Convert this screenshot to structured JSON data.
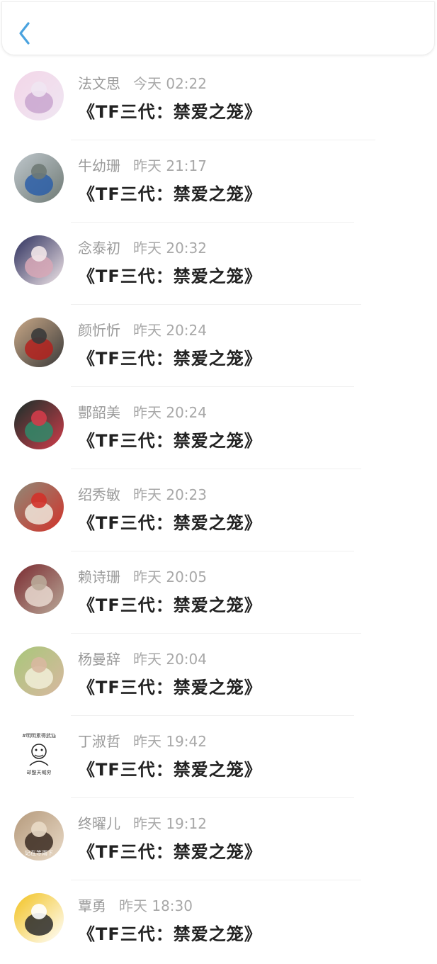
{
  "header": {
    "back_icon": "chevron-left-icon",
    "accent": "#4aa3df"
  },
  "items": [
    {
      "name": "法文思",
      "time": "今天 02:22",
      "title": "《TF三代：禁爱之笼》",
      "avatar": {
        "c1": "#f3d6e8",
        "c2": "#c9a6cf",
        "c3": "#efe6f2"
      }
    },
    {
      "name": "牛幼珊",
      "time": "昨天 21:17",
      "title": "《TF三代：禁爱之笼》",
      "avatar": {
        "c1": "#bfc7cc",
        "c2": "#2d5fa8",
        "c3": "#6f7a75"
      }
    },
    {
      "name": "念泰初",
      "time": "昨天 20:32",
      "title": "《TF三代：禁爱之笼》",
      "avatar": {
        "c1": "#2b2e5c",
        "c2": "#d7a7b6",
        "c3": "#f1e5e8"
      }
    },
    {
      "name": "颜忻忻",
      "time": "昨天 20:24",
      "title": "《TF三代：禁爱之笼》",
      "avatar": {
        "c1": "#c9a887",
        "c2": "#b3221e",
        "c3": "#3a3a3a"
      }
    },
    {
      "name": "酆韶美",
      "time": "昨天 20:24",
      "title": "《TF三代：禁爱之笼》",
      "avatar": {
        "c1": "#15302a",
        "c2": "#2f8a6a",
        "c3": "#d13c4a"
      }
    },
    {
      "name": "绍秀敏",
      "time": "昨天 20:23",
      "title": "《TF三代：禁爱之笼》",
      "avatar": {
        "c1": "#8f8a78",
        "c2": "#efe7dc",
        "c3": "#d2322a"
      }
    },
    {
      "name": "赖诗珊",
      "time": "昨天 20:05",
      "title": "《TF三代：禁爱之笼》",
      "avatar": {
        "c1": "#7a2a30",
        "c2": "#e7d8cf",
        "c3": "#b9a898"
      }
    },
    {
      "name": "杨曼辞",
      "time": "昨天 20:04",
      "title": "《TF三代：禁爱之笼》",
      "avatar": {
        "c1": "#a8c77a",
        "c2": "#f1eed8",
        "c3": "#d8b8a0"
      }
    },
    {
      "name": "丁淑哲",
      "time": "昨天 19:42",
      "title": "《TF三代：禁爱之笼》",
      "avatar": {
        "c1": "#ffffff",
        "c2": "#222222",
        "c3": "#666666",
        "line1": "#明明累得武油",
        "line2": "却整天喊穷"
      }
    },
    {
      "name": "终曜儿",
      "time": "昨天 19:12",
      "title": "《TF三代：禁爱之笼》",
      "avatar": {
        "c1": "#b59a7c",
        "c2": "#3b2b22",
        "c3": "#e9dac7",
        "caption": "记在等雨下"
      }
    },
    {
      "name": "覃勇",
      "time": "昨天 18:30",
      "title": "《TF三代：禁爱之笼》",
      "avatar": {
        "c1": "#f2c21f",
        "c2": "#2b2b2b",
        "c3": "#ffffff"
      }
    }
  ],
  "colors": {
    "name": "#9a9a9a",
    "time": "#a8a8a8",
    "title": "#222222",
    "divider": "#f0f0f0"
  }
}
